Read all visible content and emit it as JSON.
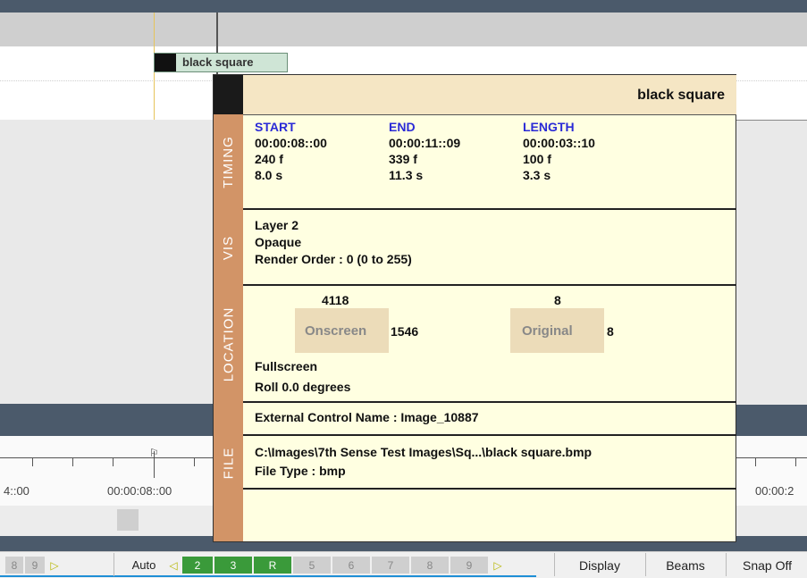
{
  "timeline": {
    "clip_label": "black square",
    "ruler_left_partial": "4::00",
    "ruler_center": "00:00:08::00",
    "ruler_right_partial": "00:00:2"
  },
  "popup": {
    "title": "black square",
    "timing": {
      "section_label": "TIMING",
      "start_header": "START",
      "end_header": "END",
      "length_header": "LENGTH",
      "start_tc": "00:00:08::00",
      "end_tc": "00:00:11::09",
      "length_tc": "00:00:03::10",
      "start_frames": "240 f",
      "end_frames": "339 f",
      "length_frames": "100 f",
      "start_sec": "8.0 s",
      "end_sec": "11.3 s",
      "length_sec": "3.3 s"
    },
    "vis": {
      "section_label": "VIS",
      "layer": "Layer 2",
      "opacity": "Opaque",
      "render_order": "Render Order : 0  (0 to 255)"
    },
    "location": {
      "section_label": "LOCATION",
      "onscreen_width": "4118",
      "onscreen_label": "Onscreen",
      "onscreen_height": "1546",
      "original_width": "8",
      "original_label": "Original",
      "original_height": "8",
      "mode": "Fullscreen",
      "roll": "Roll 0.0 degrees"
    },
    "external_control": "External Control Name : Image_10887",
    "file": {
      "section_label": "FILE",
      "path": "C:\\Images\\7th Sense Test Images\\Sq...\\black square.bmp",
      "type": "File Type : bmp"
    }
  },
  "bottom_bar": {
    "left_nums": [
      "8",
      "9"
    ],
    "auto_label": "Auto",
    "active_buttons": [
      "2",
      "3",
      "R"
    ],
    "inactive_buttons": [
      "5",
      "6",
      "7",
      "8",
      "9"
    ],
    "display_label": "Display",
    "beams_label": "Beams",
    "snap_label": "Snap Off"
  },
  "colors": {
    "accent_tan": "#d29467",
    "popup_bg": "#ffffe1",
    "header_blue": "#2a2ad6",
    "track_bar": "#4b5a6b",
    "green_btn": "#3a9a3a"
  }
}
